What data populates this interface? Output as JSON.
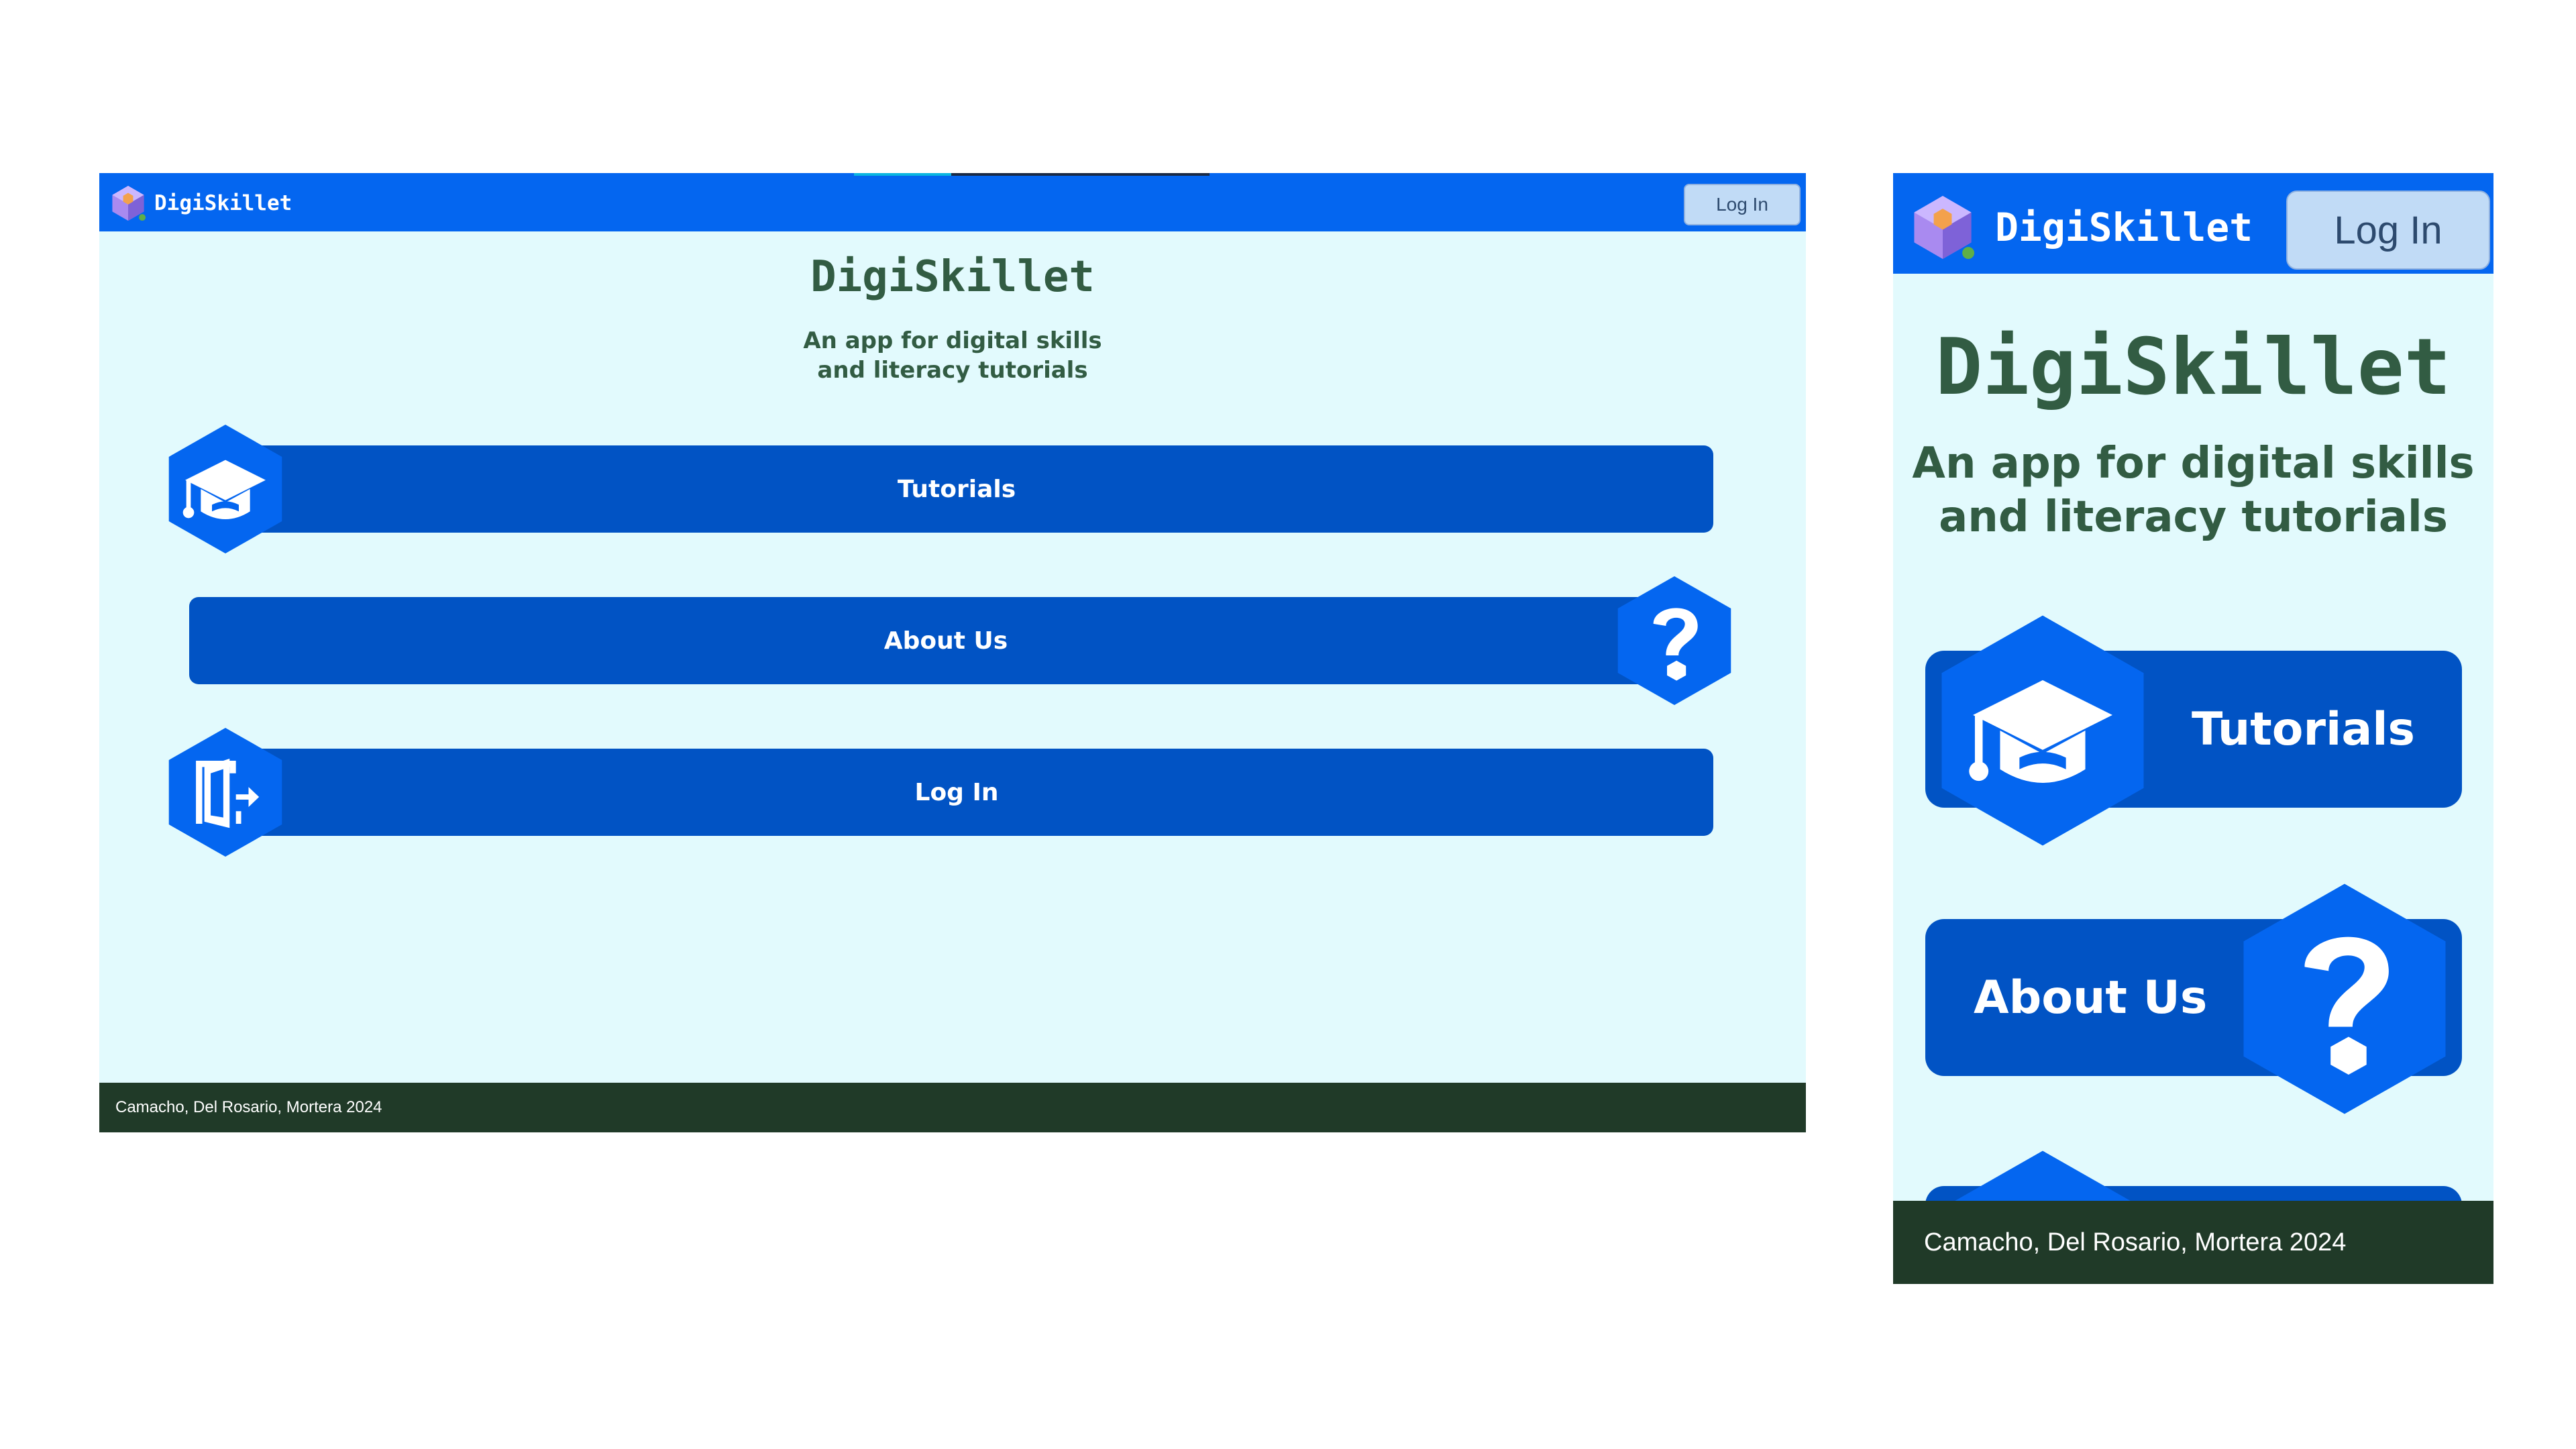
{
  "app": {
    "name": "DigiSkillet",
    "login_button": "Log In"
  },
  "hero": {
    "title": "DigiSkillet",
    "subtitle_line1": "An app for digital skills",
    "subtitle_line2": "and literacy tutorials"
  },
  "menu": {
    "items": [
      {
        "label": "Tutorials",
        "icon": "graduation-cap-icon"
      },
      {
        "label": "About Us",
        "icon": "question-mark-icon"
      },
      {
        "label": "Log In",
        "icon": "login-door-icon"
      }
    ]
  },
  "footer": {
    "credits": "Camacho, Del Rosario, Mortera 2024"
  },
  "colors": {
    "navbar": "#0466f0",
    "background": "#e2fafd",
    "menu_bar": "#0153c4",
    "hex_icon": "#0466f0",
    "title_text": "#325c43",
    "footer": "#203a28",
    "login_button_bg": "#c1dbf6"
  }
}
